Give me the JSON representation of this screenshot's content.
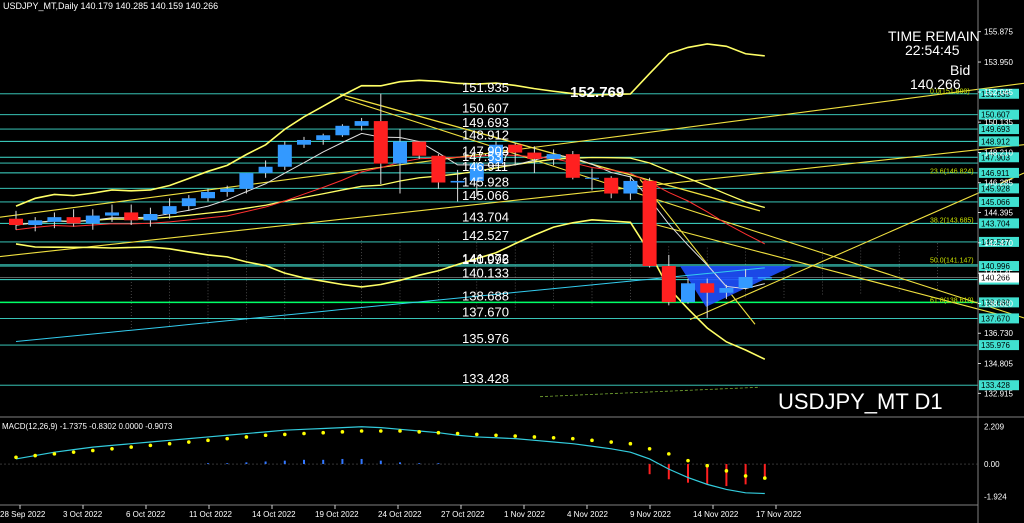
{
  "header": {
    "title": "USDJPY_MT,Daily  140.179 140.285 140.159 140.266"
  },
  "info_box": {
    "time_remain_label": "TIME REMAIN",
    "time_remain_value": "22:54:45",
    "bid_label": "Bid",
    "bid_value": "140.266"
  },
  "symbol_label": "USDJPY_MT D1",
  "peak_label": "152.769",
  "colors": {
    "bull_candle": "#3399ff",
    "bear_candle": "#ff2020",
    "level_line": "#40e0d0",
    "yellow": "#f0e040",
    "bollinger": "#ffff66",
    "fib": "#c8e000",
    "white_ma": "#e0e0e0",
    "red_ma": "#ff3030",
    "macd_line": "#33ccdd",
    "macd_signal": "#ffff00",
    "blue_triangle": "#1e50ff"
  },
  "chart_data": {
    "type": "candlestick",
    "title": "USDJPY_MT,Daily",
    "ylim": [
      131.6,
      157.0
    ],
    "y_ticks": [
      "155.875",
      "153.950",
      "152.045",
      "150.135",
      "148.210",
      "146.285",
      "144.395",
      "142.470",
      "140.545",
      "138.620",
      "136.730",
      "134.805",
      "132.915"
    ],
    "x_labels": [
      "28 Sep 2022",
      "3 Oct 2022",
      "6 Oct 2022",
      "11 Oct 2022",
      "14 Oct 2022",
      "19 Oct 2022",
      "24 Oct 2022",
      "27 Oct 2022",
      "1 Nov 2022",
      "4 Nov 2022",
      "9 Nov 2022",
      "14 Nov 2022",
      "17 Nov 2022"
    ],
    "candles": [
      {
        "d": "26 Sep",
        "o": 144.0,
        "h": 144.5,
        "l": 143.3,
        "c": 143.6
      },
      {
        "d": "27 Sep",
        "o": 143.6,
        "h": 144.1,
        "l": 143.2,
        "c": 143.9
      },
      {
        "d": "28 Sep",
        "o": 143.8,
        "h": 144.4,
        "l": 143.4,
        "c": 144.1
      },
      {
        "d": "29 Sep",
        "o": 144.1,
        "h": 144.6,
        "l": 143.5,
        "c": 143.7
      },
      {
        "d": "30 Sep",
        "o": 143.7,
        "h": 144.6,
        "l": 143.3,
        "c": 144.2
      },
      {
        "d": "3 Oct",
        "o": 144.2,
        "h": 144.9,
        "l": 143.8,
        "c": 144.4
      },
      {
        "d": "4 Oct",
        "o": 144.4,
        "h": 144.9,
        "l": 143.6,
        "c": 143.9
      },
      {
        "d": "5 Oct",
        "o": 143.9,
        "h": 144.7,
        "l": 143.5,
        "c": 144.3
      },
      {
        "d": "6 Oct",
        "o": 144.3,
        "h": 145.3,
        "l": 144.0,
        "c": 144.8
      },
      {
        "d": "7 Oct",
        "o": 144.8,
        "h": 145.5,
        "l": 144.5,
        "c": 145.3
      },
      {
        "d": "10 Oct",
        "o": 145.3,
        "h": 145.9,
        "l": 145.1,
        "c": 145.7
      },
      {
        "d": "11 Oct",
        "o": 145.7,
        "h": 146.1,
        "l": 145.4,
        "c": 145.9
      },
      {
        "d": "12 Oct",
        "o": 145.9,
        "h": 146.9,
        "l": 145.6,
        "c": 146.9
      },
      {
        "d": "13 Oct",
        "o": 146.9,
        "h": 147.7,
        "l": 146.6,
        "c": 147.3
      },
      {
        "d": "14 Oct",
        "o": 147.3,
        "h": 148.9,
        "l": 147.1,
        "c": 148.7
      },
      {
        "d": "17 Oct",
        "o": 148.7,
        "h": 149.2,
        "l": 148.5,
        "c": 149.0
      },
      {
        "d": "18 Oct",
        "o": 149.0,
        "h": 149.4,
        "l": 148.7,
        "c": 149.3
      },
      {
        "d": "19 Oct",
        "o": 149.3,
        "h": 150.0,
        "l": 149.2,
        "c": 149.9
      },
      {
        "d": "20 Oct",
        "o": 149.9,
        "h": 150.4,
        "l": 149.6,
        "c": 150.2
      },
      {
        "d": "21 Oct",
        "o": 150.2,
        "h": 151.935,
        "l": 146.2,
        "c": 147.5
      },
      {
        "d": "24 Oct",
        "o": 147.5,
        "h": 149.7,
        "l": 145.6,
        "c": 148.9
      },
      {
        "d": "25 Oct",
        "o": 148.9,
        "h": 148.9,
        "l": 147.8,
        "c": 148.0
      },
      {
        "d": "26 Oct",
        "o": 148.0,
        "h": 148.1,
        "l": 145.9,
        "c": 146.3
      },
      {
        "d": "27 Oct",
        "o": 146.3,
        "h": 147.1,
        "l": 145.1,
        "c": 146.4
      },
      {
        "d": "28 Oct",
        "o": 146.4,
        "h": 147.6,
        "l": 145.4,
        "c": 147.5
      },
      {
        "d": "31 Oct",
        "o": 147.5,
        "h": 148.9,
        "l": 147.3,
        "c": 148.7
      },
      {
        "d": "1 Nov",
        "o": 148.7,
        "h": 148.8,
        "l": 147.4,
        "c": 148.2
      },
      {
        "d": "2 Nov",
        "o": 148.2,
        "h": 148.6,
        "l": 146.9,
        "c": 147.8
      },
      {
        "d": "3 Nov",
        "o": 147.8,
        "h": 148.4,
        "l": 147.4,
        "c": 148.1
      },
      {
        "d": "4 Nov",
        "o": 148.1,
        "h": 148.3,
        "l": 146.5,
        "c": 146.6
      },
      {
        "d": "7 Nov",
        "o": 146.6,
        "h": 147.2,
        "l": 145.8,
        "c": 146.6
      },
      {
        "d": "8 Nov",
        "o": 146.6,
        "h": 146.7,
        "l": 145.3,
        "c": 145.6
      },
      {
        "d": "9 Nov",
        "o": 145.6,
        "h": 146.7,
        "l": 145.2,
        "c": 146.4
      },
      {
        "d": "10 Nov",
        "o": 146.4,
        "h": 146.6,
        "l": 140.9,
        "c": 141.0
      },
      {
        "d": "11 Nov",
        "o": 141.0,
        "h": 141.7,
        "l": 138.5,
        "c": 138.7
      },
      {
        "d": "14 Nov",
        "o": 138.7,
        "h": 140.2,
        "l": 138.6,
        "c": 139.9
      },
      {
        "d": "15 Nov",
        "o": 139.9,
        "h": 140.2,
        "l": 137.7,
        "c": 139.3
      },
      {
        "d": "16 Nov",
        "o": 139.3,
        "h": 139.8,
        "l": 138.9,
        "c": 139.6
      },
      {
        "d": "17 Nov",
        "o": 139.6,
        "h": 140.8,
        "l": 139.5,
        "c": 140.3
      },
      {
        "d": "18 Nov",
        "o": 140.2,
        "h": 140.3,
        "l": 140.2,
        "c": 140.3
      }
    ],
    "levels": [
      {
        "value": 151.935,
        "label": "151.935",
        "box": "151.935"
      },
      {
        "value": 150.607,
        "label": "150.607",
        "box": "150.607"
      },
      {
        "value": 149.693,
        "label": "149.693",
        "box": "149.693"
      },
      {
        "value": 148.912,
        "label": "148.912",
        "box": "148.912"
      },
      {
        "value": 147.903,
        "label": "147.903",
        "box": "147.903"
      },
      {
        "value": 147.537,
        "label": "147.537",
        "box": ""
      },
      {
        "value": 146.911,
        "label": "146.911",
        "box": "146.911"
      },
      {
        "value": 145.928,
        "label": "145.928",
        "box": "145.928"
      },
      {
        "value": 145.066,
        "label": "145.066",
        "box": "145.066"
      },
      {
        "value": 143.704,
        "label": "143.704",
        "box": "143.704"
      },
      {
        "value": 142.527,
        "label": "142.527",
        "box": "142.527"
      },
      {
        "value": 141.072,
        "label": "141.072",
        "box": ""
      },
      {
        "value": 140.996,
        "label": "140.996",
        "box": "140.996"
      },
      {
        "value": 140.133,
        "label": "140.133",
        "box": "140.133"
      },
      {
        "value": 138.688,
        "label": "138.688",
        "box": "138.688"
      },
      {
        "value": 137.67,
        "label": "137.670",
        "box": "137.670"
      },
      {
        "value": 135.976,
        "label": "135.976",
        "box": "135.976"
      },
      {
        "value": 133.428,
        "label": "133.428",
        "box": "133.428"
      }
    ],
    "fib_levels": [
      {
        "label": "0.0(151.899)",
        "value": 151.899
      },
      {
        "label": "23.6(146.824)",
        "value": 146.824
      },
      {
        "label": "38.2(143.685)",
        "value": 143.685
      },
      {
        "label": "50.0(141.147)",
        "value": 141.147
      },
      {
        "label": "61.8(138.610)",
        "value": 138.61
      }
    ],
    "current_price": {
      "value": 140.266,
      "box": "140.266"
    },
    "macd": {
      "title": "MACD(12,26,9) -1.7375 -0.8302 0.0000 -0.9073",
      "ylim": [
        -2.3,
        2.6
      ],
      "y_ticks": [
        "2.209",
        "0.00",
        "-1.924"
      ],
      "line": [
        0.3,
        0.5,
        0.7,
        0.85,
        1.0,
        1.1,
        1.2,
        1.3,
        1.4,
        1.5,
        1.6,
        1.7,
        1.8,
        1.9,
        2.0,
        2.05,
        2.1,
        2.15,
        2.2,
        2.15,
        2.05,
        1.95,
        1.85,
        1.7,
        1.6,
        1.55,
        1.5,
        1.4,
        1.3,
        1.2,
        1.05,
        0.9,
        0.7,
        0.3,
        -0.3,
        -0.8,
        -1.2,
        -1.5,
        -1.7,
        -1.74
      ],
      "signal": [
        0.4,
        0.5,
        0.6,
        0.7,
        0.8,
        0.9,
        1.0,
        1.1,
        1.2,
        1.3,
        1.4,
        1.5,
        1.6,
        1.7,
        1.75,
        1.8,
        1.85,
        1.9,
        1.95,
        1.95,
        1.95,
        1.9,
        1.85,
        1.8,
        1.75,
        1.7,
        1.65,
        1.6,
        1.55,
        1.5,
        1.4,
        1.3,
        1.2,
        0.9,
        0.6,
        0.2,
        -0.1,
        -0.4,
        -0.7,
        -0.83
      ],
      "hist": [
        0.0,
        0.0,
        0.0,
        0.0,
        0.0,
        0.0,
        0.0,
        0.0,
        0.0,
        0.0,
        0.05,
        0.05,
        0.1,
        0.15,
        0.2,
        0.25,
        0.25,
        0.3,
        0.3,
        0.2,
        0.1,
        0.05,
        0.05,
        0.0,
        0.0,
        0.0,
        0.0,
        0.0,
        0.0,
        0.0,
        0.0,
        0.0,
        0.0,
        -0.6,
        -0.9,
        -1.1,
        -1.2,
        -1.3,
        -1.2,
        -0.91
      ]
    }
  }
}
